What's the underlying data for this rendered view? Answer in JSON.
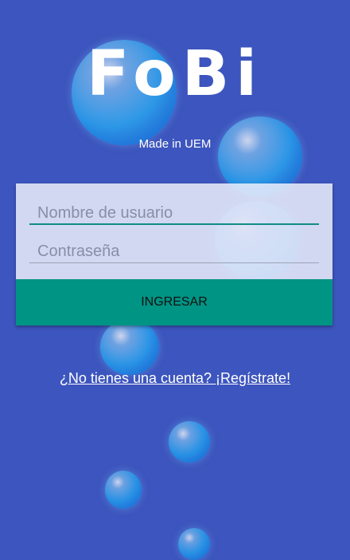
{
  "app": {
    "logo_text": "FoBi",
    "tagline": "Made in UEM"
  },
  "login_form": {
    "username_placeholder": "Nombre de usuario",
    "password_placeholder": "Contraseña",
    "submit_label": "INGRESAR"
  },
  "register_link": "¿No tienes una cuenta? ¡Regístrate!",
  "colors": {
    "background": "#3d55be",
    "accent": "#009484",
    "text": "#ffffff"
  }
}
